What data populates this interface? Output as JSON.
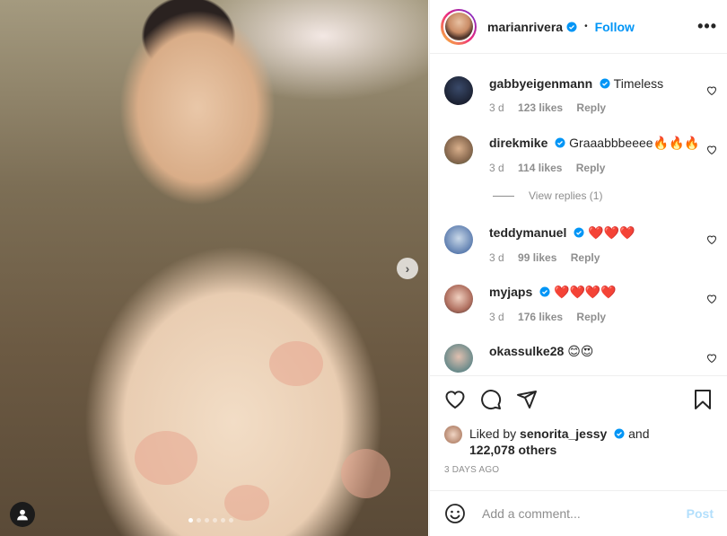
{
  "post": {
    "username": "marianrivera",
    "separator": "•",
    "follow_label": "Follow",
    "more_label": "•••",
    "carousel_count": 6,
    "carousel_active": 0
  },
  "comments": [
    {
      "user": "gabbyeigenmann",
      "verified": true,
      "text": "Timeless",
      "age": "3 d",
      "likes": "123 likes",
      "reply": "Reply"
    },
    {
      "user": "direkmike",
      "verified": true,
      "text": "Graaabbbeeee🔥🔥🔥",
      "age": "3 d",
      "likes": "114 likes",
      "reply": "Reply"
    },
    {
      "user": "teddymanuel",
      "verified": true,
      "text": "❤️❤️❤️",
      "age": "3 d",
      "likes": "99 likes",
      "reply": "Reply"
    },
    {
      "user": "myjaps",
      "verified": true,
      "text": "❤️❤️❤️❤️",
      "age": "3 d",
      "likes": "176 likes",
      "reply": "Reply"
    },
    {
      "user": "okassulke28",
      "verified": false,
      "text": "😊😍",
      "age": "",
      "likes": "",
      "reply": ""
    }
  ],
  "view_replies": "View replies (1)",
  "likes": {
    "prefix": "Liked by",
    "user": "senorita_jessy",
    "and": "and",
    "others": "122,078 others"
  },
  "date": "3 DAYS AGO",
  "add_comment": {
    "placeholder": "Add a comment...",
    "post_label": "Post"
  },
  "colors": {
    "accent": "#0095f6",
    "post_disabled": "#b2dffc",
    "heart_red": "#ed4956"
  }
}
